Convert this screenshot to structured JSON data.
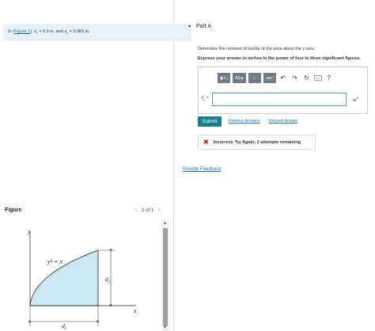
{
  "problem": {
    "prefix": "In (",
    "figure_link": "Figure 1",
    "suffix_open": "), ",
    "dx_label": "d",
    "dx_sub": "x",
    "dx_value": " = 0.9 in. and ",
    "dy_label": "d",
    "dy_sub": "y",
    "dy_value": " = 0.965 in."
  },
  "figure_panel": {
    "title": "Figure",
    "pager_prev": "<",
    "pager_text": "1 of 1",
    "pager_next": ">",
    "labels": {
      "y_axis": "y",
      "x_axis": "x",
      "curve": "y³ = x",
      "dy": "d",
      "dy_sub": "y",
      "dx": "d",
      "dx_sub": "x"
    }
  },
  "part": {
    "label": "Part A",
    "question": "Determine the moment of inertia of the area about the y axis.",
    "instruction": "Express your answer in inches to the power of four to three significant figures."
  },
  "toolbar": {
    "templates": "▮√□",
    "greek": "ΑΣφ",
    "arrows": "↓↑",
    "vec": "vec",
    "undo": "↶",
    "redo": "↷",
    "reset": "↻",
    "keyboard": "▭",
    "help": "?"
  },
  "answer": {
    "label": "I",
    "label_sub": "y",
    "equals": " =",
    "value": "",
    "unit": "in",
    "unit_exp": "4"
  },
  "actions": {
    "submit": "Submit",
    "previous_answers": "Previous Answers",
    "request_answer": "Request Answer"
  },
  "feedback": {
    "icon": "✖",
    "message": "Incorrect; Try Again; 2 attempts remaining"
  },
  "provide_feedback": "Provide Feedback",
  "colors": {
    "accent": "#1b7f8a",
    "link": "#1a6fb4",
    "problem_bg": "#e6f2f7",
    "region_fill": "#cde6f3",
    "error": "#c0312b"
  }
}
